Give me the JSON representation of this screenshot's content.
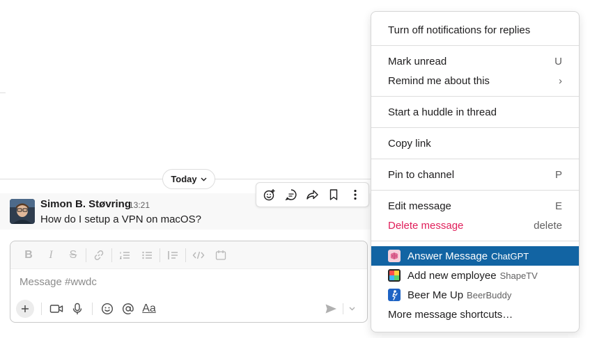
{
  "date_divider": {
    "label": "Today"
  },
  "message": {
    "author": "Simon B. Støvring",
    "time": "13:21",
    "text": "How do I setup a VPN on macOS?"
  },
  "message_actions": [
    "add-reaction-icon",
    "reply-in-thread-icon",
    "share-icon",
    "bookmark-icon",
    "more-actions-icon"
  ],
  "composer": {
    "placeholder": "Message #wwdc",
    "format_label": "Aa"
  },
  "context_menu": {
    "items": [
      {
        "label": "Turn off notifications for replies",
        "shortcut": ""
      },
      {
        "label": "Mark unread",
        "shortcut": "U"
      },
      {
        "label": "Remind me about this",
        "shortcut": "›"
      },
      {
        "label": "Start a huddle in thread",
        "shortcut": ""
      },
      {
        "label": "Copy link",
        "shortcut": ""
      },
      {
        "label": "Pin to channel",
        "shortcut": "P"
      },
      {
        "label": "Edit message",
        "shortcut": "E"
      },
      {
        "label": "Delete message",
        "shortcut": "delete"
      },
      {
        "label": "Answer Message",
        "app": "ChatGPT"
      },
      {
        "label": "Add new employee",
        "app": "ShapeTV"
      },
      {
        "label": "Beer Me Up",
        "app": "BeerBuddy"
      },
      {
        "label": "More message shortcuts…",
        "shortcut": ""
      }
    ]
  },
  "colors": {
    "highlight": "#1264a3",
    "danger": "#e01e5a"
  }
}
